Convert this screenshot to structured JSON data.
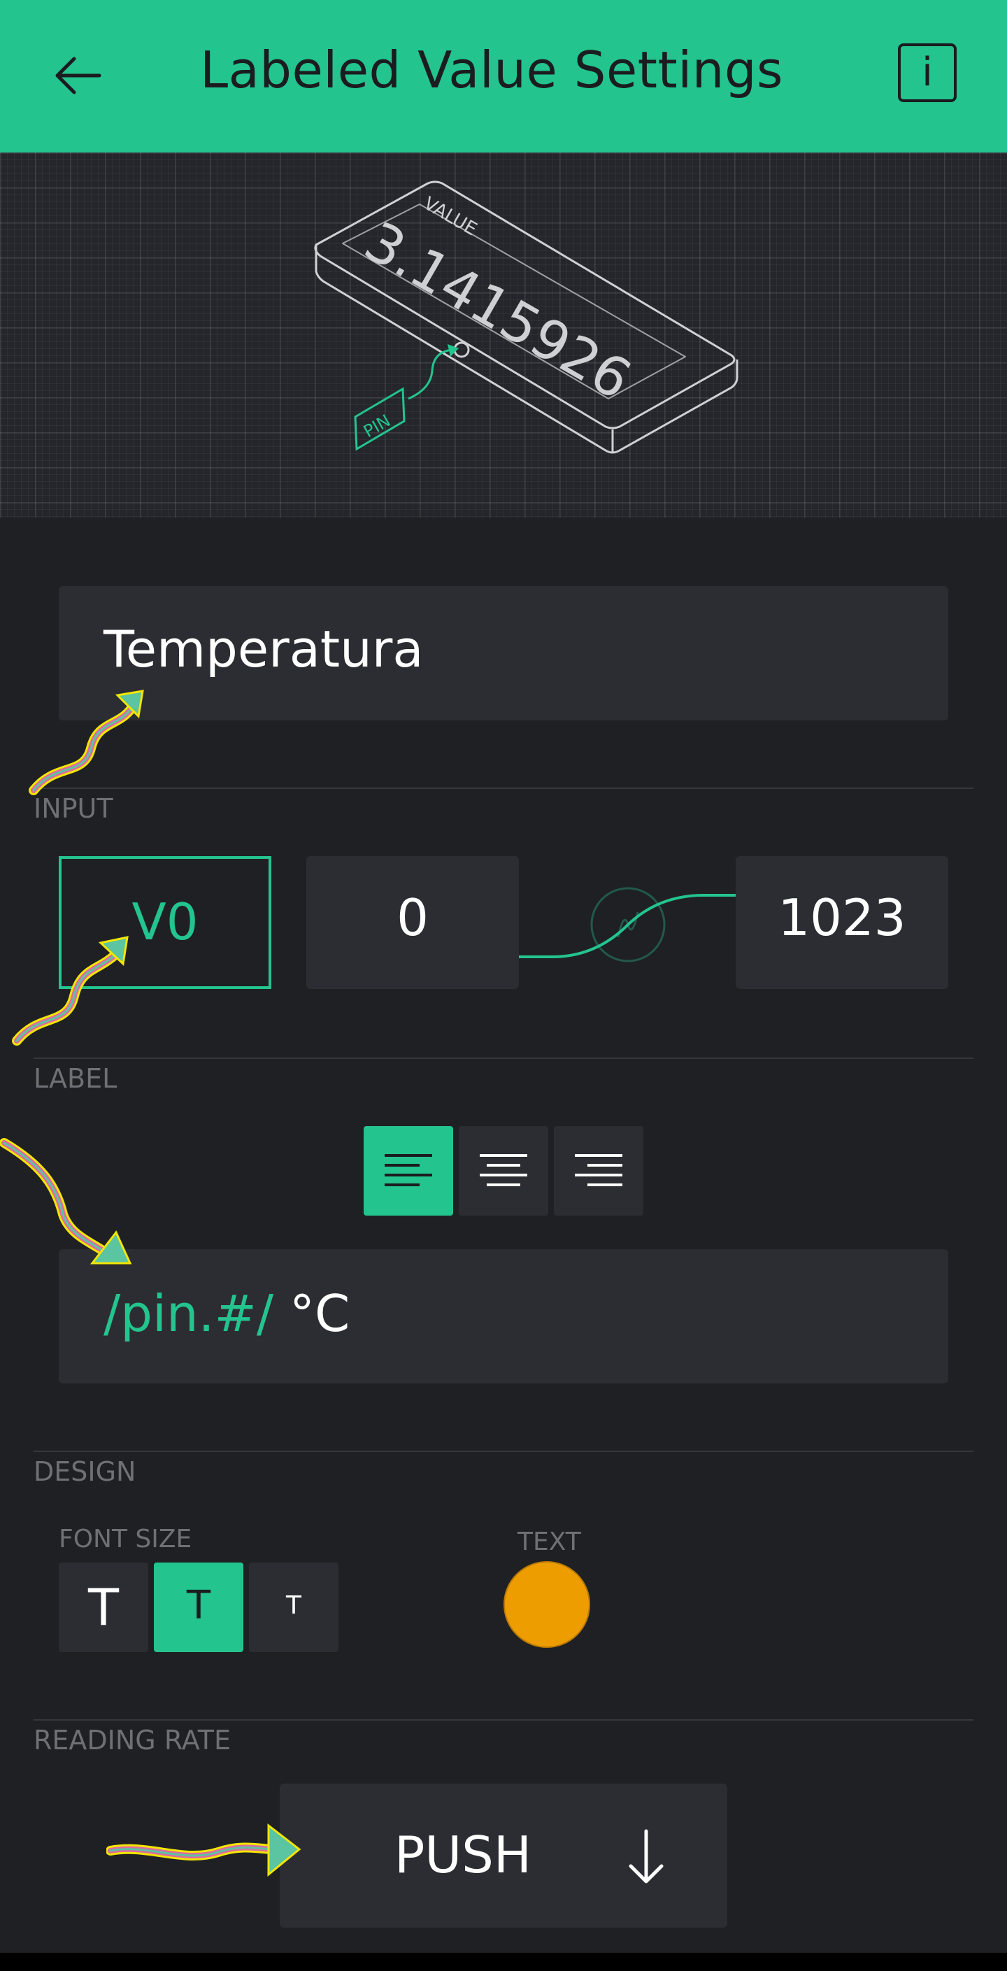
{
  "header": {
    "title": "Labeled Value Settings",
    "back_icon": "arrow-left-icon",
    "info_label": "i",
    "background_color": "#23c48e"
  },
  "hero": {
    "widget_caption": "VALUE",
    "widget_value": "3.1415926",
    "pin_tag": "PIN",
    "accent_color": "#23c48e"
  },
  "name_field": {
    "value": "Temperatura"
  },
  "input": {
    "section_label": "INPUT",
    "pin": "V0",
    "min": "0",
    "max": "1023",
    "curve_icon": "mapping-curve-icon"
  },
  "label": {
    "section_label": "LABEL",
    "alignment_options": [
      "left",
      "center",
      "right"
    ],
    "selected_alignment": "left",
    "format_token": "/pin.#/",
    "format_suffix": "°C"
  },
  "design": {
    "section_label": "DESIGN",
    "font_size_label": "FONT SIZE",
    "font_sizes": [
      "T",
      "T",
      "T"
    ],
    "selected_font_size_index": 1,
    "text_color_label": "TEXT",
    "text_color": "#ed9d00"
  },
  "reading_rate": {
    "section_label": "READING RATE",
    "value": "PUSH",
    "dropdown_icon": "arrow-down-icon"
  }
}
